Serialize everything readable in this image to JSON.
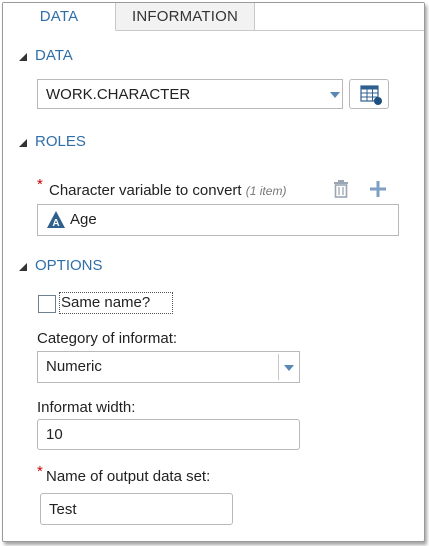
{
  "tabs": [
    {
      "label": "DATA",
      "active": true
    },
    {
      "label": "INFORMATION",
      "active": false
    }
  ],
  "data_section": {
    "title": "DATA",
    "dataset_value": "WORK.CHARACTER"
  },
  "roles_section": {
    "title": "ROLES",
    "required_marker": "*",
    "char_var_label": "Character variable to convert",
    "char_var_hint": "(1 item)",
    "assigned_items": [
      {
        "label": "Age",
        "icon": "character-variable-icon"
      }
    ]
  },
  "options_section": {
    "title": "OPTIONS",
    "same_name_label": "Same name?",
    "same_name_checked": false,
    "category_label": "Category of informat:",
    "category_value": "Numeric",
    "width_label": "Informat width:",
    "width_value": "10",
    "required_marker": "*",
    "output_label": "Name of output data set:",
    "output_value": "Test"
  },
  "colors": {
    "accent": "#2f6fa8",
    "required": "#cc0000",
    "icon_gray": "#9aa6b3"
  }
}
